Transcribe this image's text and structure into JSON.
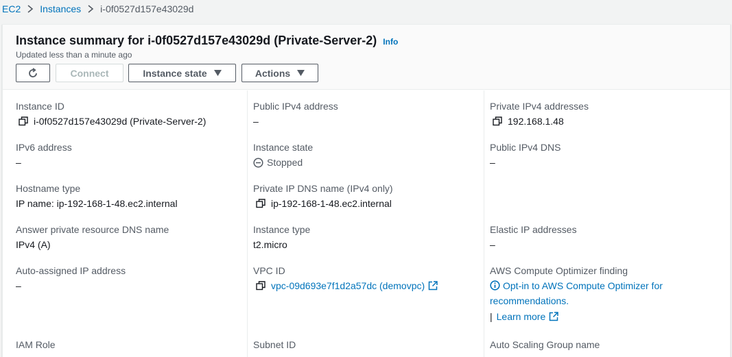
{
  "breadcrumb": {
    "items": [
      "EC2",
      "Instances"
    ],
    "current": "i-0f0527d157e43029d"
  },
  "header": {
    "title": "Instance summary for i-0f0527d157e43029d (Private-Server-2)",
    "info": "Info",
    "updated": "Updated less than a minute ago"
  },
  "toolbar": {
    "refresh_icon": "refresh-icon",
    "connect_label": "Connect",
    "instance_state_label": "Instance state",
    "actions_label": "Actions"
  },
  "details": {
    "instance_id": {
      "label": "Instance ID",
      "value": "i-0f0527d157e43029d (Private-Server-2)"
    },
    "public_ipv4": {
      "label": "Public IPv4 address",
      "value": "–"
    },
    "private_ipv4": {
      "label": "Private IPv4 addresses",
      "value": "192.168.1.48"
    },
    "ipv6": {
      "label": "IPv6 address",
      "value": "–"
    },
    "instance_state": {
      "label": "Instance state",
      "value": "Stopped"
    },
    "public_dns": {
      "label": "Public IPv4 DNS",
      "value": "–"
    },
    "hostname_type": {
      "label": "Hostname type",
      "value": "IP name: ip-192-168-1-48.ec2.internal"
    },
    "private_dns": {
      "label": "Private IP DNS name (IPv4 only)",
      "value": "ip-192-168-1-48.ec2.internal"
    },
    "answer_dns": {
      "label": "Answer private resource DNS name",
      "value": "IPv4 (A)"
    },
    "instance_type": {
      "label": "Instance type",
      "value": "t2.micro"
    },
    "elastic_ip": {
      "label": "Elastic IP addresses",
      "value": "–"
    },
    "auto_ip": {
      "label": "Auto-assigned IP address",
      "value": "–"
    },
    "vpc_id": {
      "label": "VPC ID",
      "value": "vpc-09d693e7f1d2a57dc (demovpc)"
    },
    "optimizer": {
      "label": "AWS Compute Optimizer finding",
      "value": "Opt-in to AWS Compute Optimizer for recommendations.",
      "separator": "|",
      "learn_more": "Learn more"
    },
    "iam_role": {
      "label": "IAM Role"
    },
    "subnet_id": {
      "label": "Subnet ID"
    },
    "asg_name": {
      "label": "Auto Scaling Group name"
    }
  },
  "colors": {
    "link": "#0073bb",
    "text": "#16191f",
    "label": "#545b64",
    "background": "#f2f3f3"
  }
}
